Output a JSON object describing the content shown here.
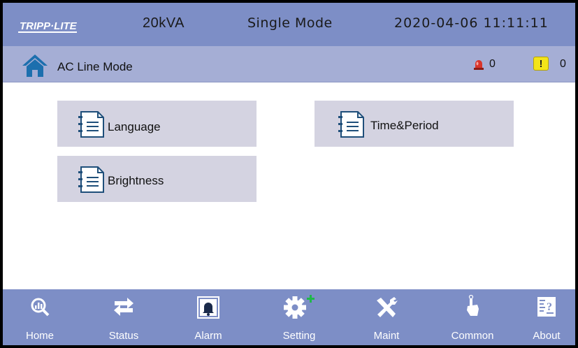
{
  "header": {
    "logo_text": "TRIPP·LITE",
    "capacity": "20kVA",
    "mode": "Single Mode",
    "datetime": "2020-04-06 11:11:11"
  },
  "status": {
    "line_mode": "AC Line Mode",
    "alarm_count": "0",
    "warning_symbol": "!",
    "warning_count": "0"
  },
  "menu": {
    "items": [
      {
        "label": "Language",
        "icon": "document-list-icon"
      },
      {
        "label": "Time&Period",
        "icon": "document-list-icon"
      },
      {
        "label": "Brightness",
        "icon": "document-list-icon"
      }
    ]
  },
  "nav": {
    "items": [
      {
        "label": "Home",
        "icon": "magnifier-chart-icon"
      },
      {
        "label": "Status",
        "icon": "swap-arrows-icon"
      },
      {
        "label": "Alarm",
        "icon": "bell-icon"
      },
      {
        "label": "Setting",
        "icon": "gear-plus-icon"
      },
      {
        "label": "Maint",
        "icon": "tools-icon"
      },
      {
        "label": "Common",
        "icon": "pointing-hand-icon"
      },
      {
        "label": "About",
        "icon": "info-document-icon"
      }
    ],
    "active": "Setting"
  },
  "colors": {
    "topbar": "#7d8ec6",
    "statusbar": "#a5aed5",
    "button": "#d4d3e1",
    "accent_plus": "#1fb84a",
    "warning": "#f3e419",
    "alarm": "#d9342b"
  }
}
